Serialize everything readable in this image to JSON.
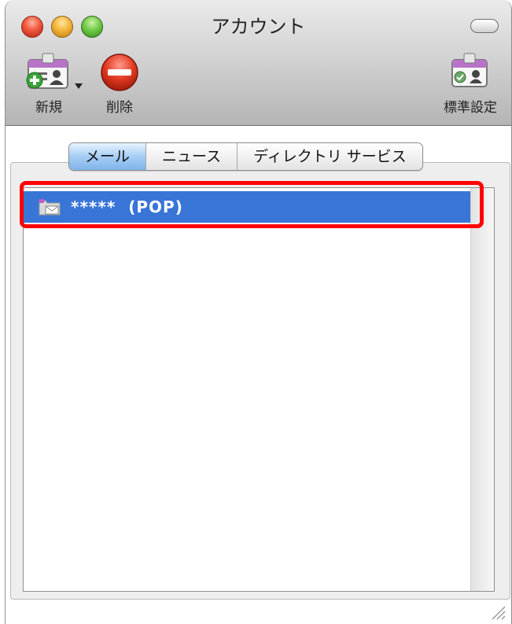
{
  "window": {
    "title": "アカウント"
  },
  "toolbar": {
    "new_label": "新規",
    "delete_label": "削除",
    "default_label": "標準設定"
  },
  "tabs": [
    {
      "label": "メール",
      "selected": true
    },
    {
      "label": "ニュース",
      "selected": false
    },
    {
      "label": "ディレクトリ サービス",
      "selected": false
    }
  ],
  "accounts": [
    {
      "name": "*****",
      "type": "(POP)",
      "selected": true
    }
  ],
  "colors": {
    "selection": "#3875d7",
    "highlight_box": "#ff0000",
    "tab_active": "#7fb4ea"
  },
  "icons": {
    "new": "add-account-card-icon",
    "delete": "delete-icon",
    "default": "default-account-card-icon",
    "account": "mail-folder-icon"
  }
}
